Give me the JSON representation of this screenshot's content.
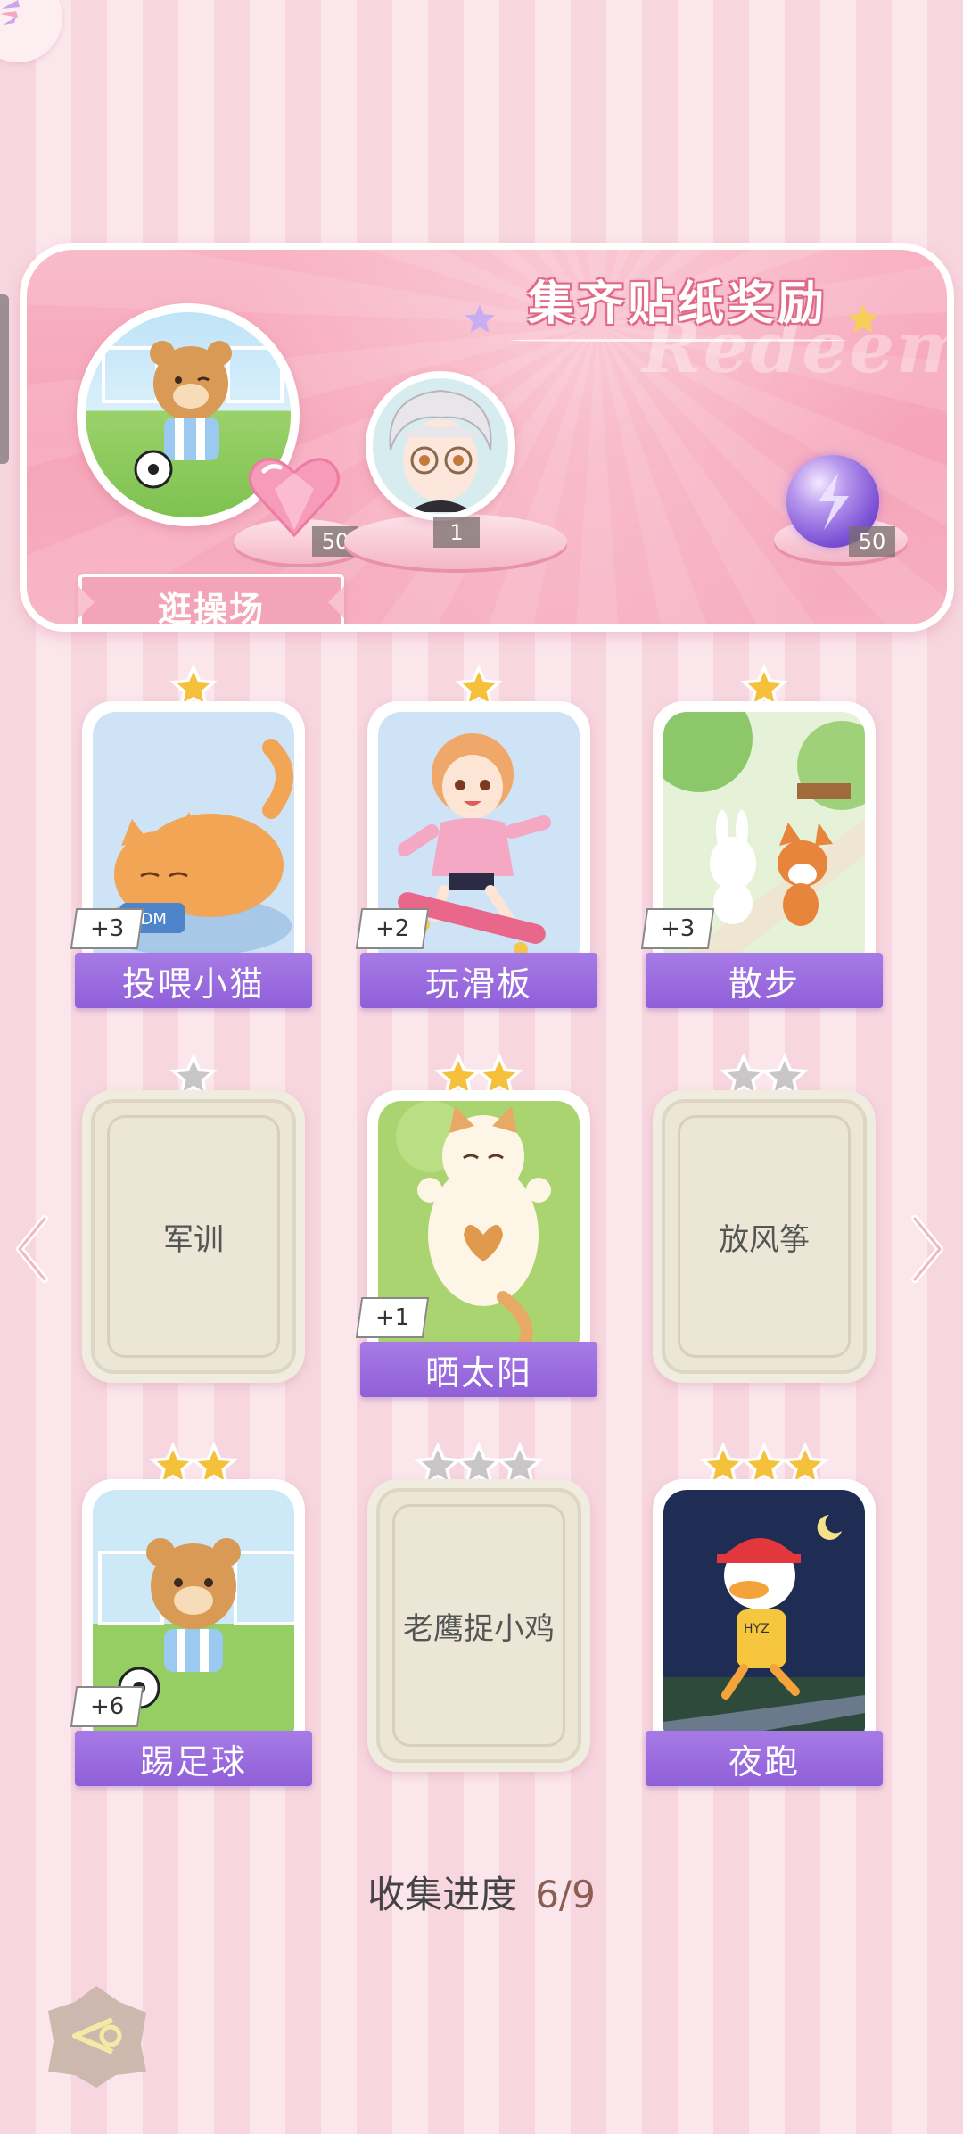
{
  "reward_panel": {
    "title": "集齐贴纸奖励",
    "watermark": "Redeem",
    "place_label": "逛操场",
    "rewards": [
      {
        "icon": "pink-heart-gem-icon",
        "count": "50"
      },
      {
        "icon": "character-avatar",
        "count": "1"
      },
      {
        "icon": "purple-orb-icon",
        "count": "50"
      }
    ]
  },
  "cards": [
    {
      "name": "投喂小猫",
      "bonus": "+3",
      "stars": 1,
      "lit": 1,
      "collected": true
    },
    {
      "name": "玩滑板",
      "bonus": "+2",
      "stars": 1,
      "lit": 1,
      "collected": true
    },
    {
      "name": "散步",
      "bonus": "+3",
      "stars": 1,
      "lit": 1,
      "collected": true
    },
    {
      "name": "军训",
      "bonus": "",
      "stars": 1,
      "lit": 0,
      "collected": false
    },
    {
      "name": "晒太阳",
      "bonus": "+1",
      "stars": 2,
      "lit": 2,
      "collected": true
    },
    {
      "name": "放风筝",
      "bonus": "",
      "stars": 2,
      "lit": 0,
      "collected": false
    },
    {
      "name": "踢足球",
      "bonus": "+6",
      "stars": 2,
      "lit": 2,
      "collected": true
    },
    {
      "name": "老鹰捉小鸡",
      "bonus": "",
      "stars": 3,
      "lit": 0,
      "collected": false
    },
    {
      "name": "夜跑",
      "bonus": "",
      "stars": 3,
      "lit": 3,
      "collected": true
    }
  ],
  "progress": {
    "label": "收集进度",
    "value": "6/9"
  },
  "colors": {
    "accent_purple": "#9b6ddf",
    "panel_pink": "#f6a4b8",
    "star_gold": "#f5c13a"
  }
}
